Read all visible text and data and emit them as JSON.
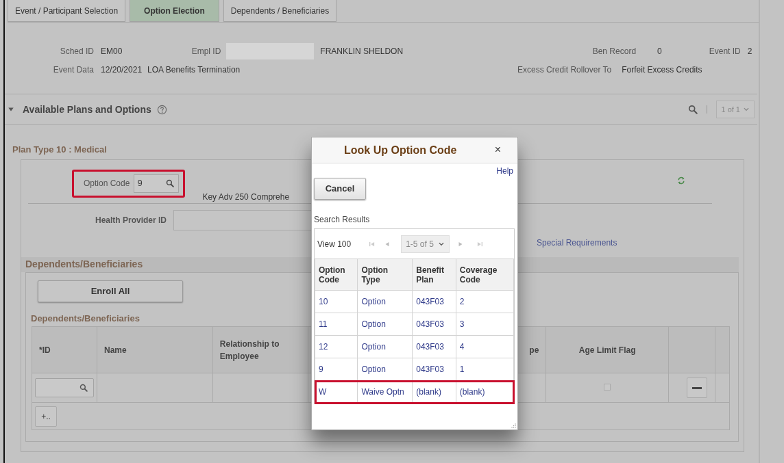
{
  "tabs": [
    {
      "label": "Event / Participant Selection",
      "selected": false
    },
    {
      "label": "Option Election",
      "selected": true
    },
    {
      "label": "Dependents / Beneficiaries",
      "selected": false
    }
  ],
  "header": {
    "sched_id": {
      "label": "Sched ID",
      "value": "EM00"
    },
    "empl_id": {
      "label": "Empl ID"
    },
    "name": "FRANKLIN SHELDON",
    "ben_record": {
      "label": "Ben Record",
      "value": "0"
    },
    "event_id": {
      "label": "Event ID",
      "value": "2"
    },
    "event_data": {
      "label": "Event Data",
      "date": "12/20/2021",
      "description": "LOA Benefits Termination"
    },
    "rollover": {
      "label": "Excess Credit Rollover To",
      "value": "Forfeit Excess Credits"
    }
  },
  "section": {
    "title": "Available Plans and Options",
    "expanded": true,
    "pager": "1 of 1"
  },
  "plan": {
    "title": "Plan Type 10 : Medical",
    "option_code": {
      "label": "Option Code",
      "value": "9",
      "highlighted": true
    },
    "description": "Key Adv 250 Comprehe",
    "health_provider": {
      "label": "Health Provider ID"
    },
    "special_link": "Special Requirements"
  },
  "dependents": {
    "title": "Dependents/Beneficiaries",
    "enroll_button": "Enroll All",
    "grid_title": "Dependents/Beneficiaries",
    "columns": [
      "*ID",
      "Name",
      "Relationship to Employee",
      "pe",
      "Age Limit Flag"
    ],
    "rows": [
      {
        "age_limit_flag": false
      }
    ],
    "add_button": "+.."
  },
  "lookup": {
    "title": "Look Up Option Code",
    "close": "×",
    "help": "Help",
    "cancel": "Cancel",
    "results_label": "Search Results",
    "view_all": "View 100",
    "range": "1-5 of 5",
    "columns": [
      "Option Code",
      "Option Type",
      "Benefit Plan",
      "Coverage Code"
    ],
    "rows": [
      {
        "cells": [
          "10",
          "Option",
          "043F03",
          "2"
        ],
        "highlighted": false
      },
      {
        "cells": [
          "11",
          "Option",
          "043F03",
          "3"
        ],
        "highlighted": false
      },
      {
        "cells": [
          "12",
          "Option",
          "043F03",
          "4"
        ],
        "highlighted": false
      },
      {
        "cells": [
          "9",
          "Option",
          "043F03",
          "1"
        ],
        "highlighted": false
      },
      {
        "cells": [
          "W",
          "Waive Optn",
          "(blank)",
          "(blank)"
        ],
        "highlighted": true
      }
    ]
  }
}
